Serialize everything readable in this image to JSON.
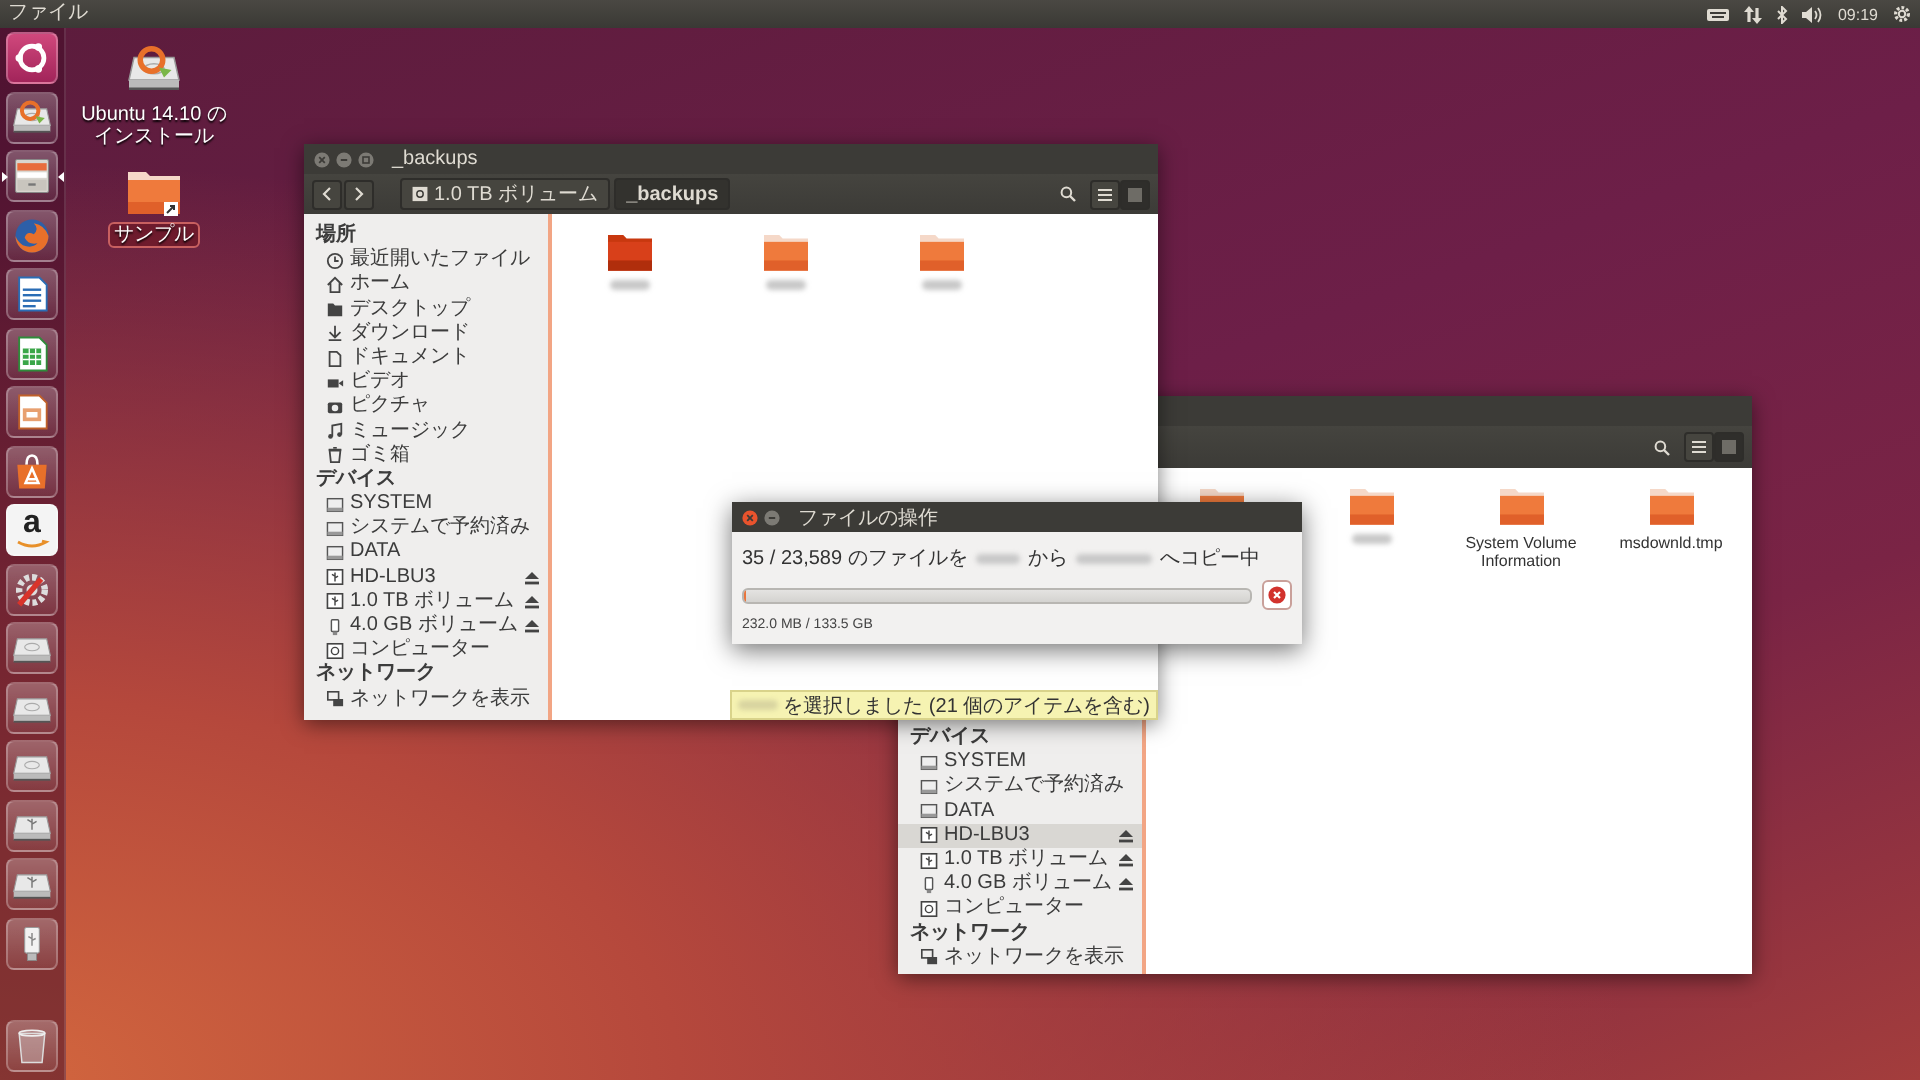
{
  "top_panel": {
    "app_menu": "ファイル",
    "clock": "09:19"
  },
  "launcher": [
    {
      "kind": "dash",
      "running": false
    },
    {
      "kind": "installer",
      "running": false
    },
    {
      "kind": "files",
      "running": true
    },
    {
      "kind": "browser",
      "running": false
    },
    {
      "kind": "writer",
      "running": false
    },
    {
      "kind": "calc",
      "running": false
    },
    {
      "kind": "impress",
      "running": false
    },
    {
      "kind": "software",
      "running": false
    },
    {
      "kind": "letter",
      "glyph": "a",
      "running": false
    },
    {
      "kind": "settings",
      "running": false
    },
    {
      "kind": "drive",
      "running": false
    },
    {
      "kind": "drive",
      "running": false
    },
    {
      "kind": "drive",
      "running": false
    },
    {
      "kind": "usb_drive",
      "running": false
    },
    {
      "kind": "usb_drive",
      "running": false
    },
    {
      "kind": "usb_stick",
      "running": false
    },
    {
      "kind": "trash",
      "running": false
    }
  ],
  "desktop_icons": [
    {
      "kind": "installer",
      "label": "Ubuntu 14.10 のインストール",
      "selected": false
    },
    {
      "kind": "folder",
      "label": "サンプル",
      "selected": true
    }
  ],
  "back_window": {
    "view_buttons": [
      {
        "kind": "list",
        "selected": false
      },
      {
        "kind": "grid",
        "selected": true
      }
    ],
    "sidebar": [
      {
        "heading": "デバイス",
        "items": [
          {
            "kind": "drive",
            "label": "SYSTEM",
            "selected": false,
            "ejectable": false
          },
          {
            "kind": "drive",
            "label": "システムで予約済み",
            "selected": false,
            "ejectable": false
          },
          {
            "kind": "drive",
            "label": "DATA",
            "selected": false,
            "ejectable": false
          },
          {
            "kind": "usb_drive",
            "label": "HD-LBU3",
            "selected": true,
            "ejectable": true
          },
          {
            "kind": "usb_drive",
            "label": "1.0 TB ボリューム",
            "selected": false,
            "ejectable": true
          },
          {
            "kind": "usb_stick",
            "label": "4.0 GB ボリューム",
            "selected": false,
            "ejectable": true
          },
          {
            "kind": "computer",
            "label": "コンピューター",
            "selected": false,
            "ejectable": false
          }
        ]
      },
      {
        "heading": "ネットワーク",
        "items": [
          {
            "kind": "network",
            "label": "ネットワークを表示",
            "selected": false,
            "ejectable": false
          }
        ]
      }
    ],
    "files": [
      {
        "kind": "folder",
        "selected": false
      },
      {
        "kind": "folder",
        "selected": false,
        "redacted": true
      },
      {
        "kind": "folder",
        "name": "System Volume Information",
        "selected": false
      },
      {
        "kind": "folder",
        "name": "msdownld.tmp",
        "selected": false
      }
    ]
  },
  "front_window": {
    "title": "_backups",
    "path": [
      {
        "kind": "drive",
        "label": "1.0 TB ボリューム",
        "selected": false
      },
      {
        "kind": "folder",
        "label": "_backups",
        "selected": true
      }
    ],
    "view_buttons": [
      {
        "kind": "list",
        "selected": false
      },
      {
        "kind": "grid",
        "selected": true
      }
    ],
    "sidebar": [
      {
        "heading": "場所",
        "items": [
          {
            "kind": "recent",
            "label": "最近開いたファイル",
            "selected": false,
            "ejectable": false
          },
          {
            "kind": "home",
            "label": "ホーム",
            "selected": false,
            "ejectable": false
          },
          {
            "kind": "desktop",
            "label": "デスクトップ",
            "selected": false,
            "ejectable": false
          },
          {
            "kind": "download",
            "label": "ダウンロード",
            "selected": false,
            "ejectable": false
          },
          {
            "kind": "document",
            "label": "ドキュメント",
            "selected": false,
            "ejectable": false
          },
          {
            "kind": "video",
            "label": "ビデオ",
            "selected": false,
            "ejectable": false
          },
          {
            "kind": "pictures",
            "label": "ピクチャ",
            "selected": false,
            "ejectable": false
          },
          {
            "kind": "music",
            "label": "ミュージック",
            "selected": false,
            "ejectable": false
          },
          {
            "kind": "trash",
            "label": "ゴミ箱",
            "selected": false,
            "ejectable": false
          }
        ]
      },
      {
        "heading": "デバイス",
        "items": [
          {
            "kind": "drive",
            "label": "SYSTEM",
            "selected": false,
            "ejectable": false
          },
          {
            "kind": "drive",
            "label": "システムで予約済み",
            "selected": false,
            "ejectable": false
          },
          {
            "kind": "drive",
            "label": "DATA",
            "selected": false,
            "ejectable": false
          },
          {
            "kind": "usb_drive",
            "label": "HD-LBU3",
            "selected": false,
            "ejectable": true
          },
          {
            "kind": "usb_drive",
            "label": "1.0 TB ボリューム",
            "selected": false,
            "ejectable": true
          },
          {
            "kind": "usb_stick",
            "label": "4.0 GB ボリューム",
            "selected": false,
            "ejectable": true
          },
          {
            "kind": "computer",
            "label": "コンピューター",
            "selected": false,
            "ejectable": false
          }
        ]
      },
      {
        "heading": "ネットワーク",
        "items": [
          {
            "kind": "network",
            "label": "ネットワークを表示",
            "selected": false,
            "ejectable": false
          }
        ]
      }
    ],
    "files": [
      {
        "kind": "folder",
        "selected": true,
        "redacted": true
      },
      {
        "kind": "folder",
        "selected": false,
        "redacted": true
      },
      {
        "kind": "folder",
        "selected": false,
        "redacted": true
      }
    ],
    "status": {
      "redacted_prefix": true,
      "text": "を選択しました (21 個のアイテムを含む)"
    }
  },
  "copy_dialog": {
    "title": "ファイルの操作",
    "message": [
      {
        "kind": "text",
        "text": "35 / 23,589 のファイルを"
      },
      {
        "kind": "redacted"
      },
      {
        "kind": "text",
        "text": "から"
      },
      {
        "kind": "redacted"
      },
      {
        "kind": "text",
        "text": "へコピー中"
      }
    ],
    "level": 0.002,
    "detail": "232.0 MB / 133.5 GB"
  }
}
